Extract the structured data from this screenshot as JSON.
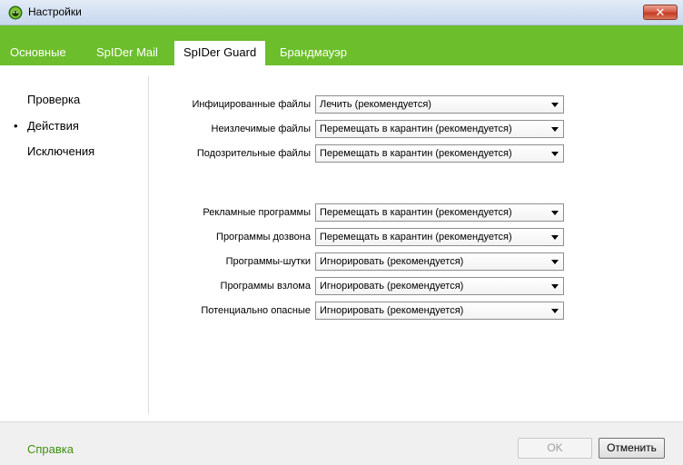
{
  "window": {
    "title": "Настройки",
    "icon": "spider-icon",
    "close_glyph": "✕"
  },
  "tabs": [
    {
      "label": "Основные",
      "active": false
    },
    {
      "label": "SpIDer Mail",
      "active": false
    },
    {
      "label": "SpIDer Guard",
      "active": true
    },
    {
      "label": "Брандмауэр",
      "active": false
    }
  ],
  "sidebar": {
    "items": [
      {
        "label": "Проверка",
        "selected": false
      },
      {
        "label": "Действия",
        "selected": true,
        "bullet": "•"
      },
      {
        "label": "Исключения",
        "selected": false
      }
    ]
  },
  "actions": {
    "group1": [
      {
        "label": "Инфицированные файлы",
        "value": "Лечить (рекомендуется)"
      },
      {
        "label": "Неизлечимые файлы",
        "value": "Перемещать в карантин (рекомендуется)"
      },
      {
        "label": "Подозрительные файлы",
        "value": "Перемещать в карантин (рекомендуется)"
      }
    ],
    "group2": [
      {
        "label": "Рекламные программы",
        "value": "Перемещать в карантин (рекомендуется)"
      },
      {
        "label": "Программы дозвона",
        "value": "Перемещать в карантин (рекомендуется)"
      },
      {
        "label": "Программы-шутки",
        "value": "Игнорировать (рекомендуется)"
      },
      {
        "label": "Программы взлома",
        "value": "Игнорировать (рекомендуется)"
      },
      {
        "label": "Потенциально опасные",
        "value": "Игнорировать (рекомендуется)"
      }
    ]
  },
  "footer": {
    "help_label": "Справка",
    "ok_label": "OK",
    "ok_enabled": false,
    "cancel_label": "Отменить"
  },
  "colors": {
    "accent_green": "#6cbe2c",
    "link_green": "#3e8f11"
  }
}
